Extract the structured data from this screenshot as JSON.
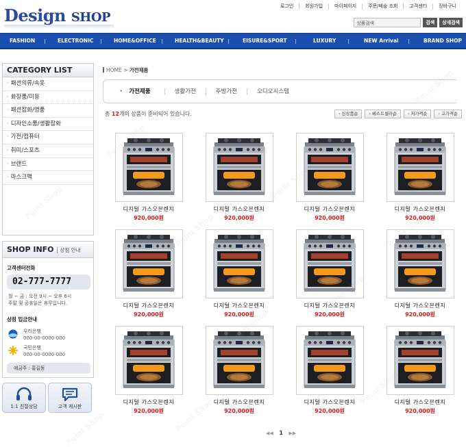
{
  "header": {
    "logo_main": "Design",
    "logo_shop": "SHOP",
    "top_links": [
      "로그인",
      "회원가입",
      "마이페이지",
      "주문/배송 조회",
      "고객센터",
      "장바구니"
    ],
    "search_placeholder": "상품검색",
    "search_button": "검색",
    "advanced_search_button": "상세검색"
  },
  "nav": [
    "FASHION",
    "ELECTRONIC",
    "HOME&OFFICE",
    "HEALTH&BEAUTY",
    "EISURE&SPORT",
    "LUXURY",
    "NEW Arrival",
    "BRAND SHOP"
  ],
  "sidebar": {
    "category_title": "CATEGORY LIST",
    "categories": [
      "패션의류/속옷",
      "화장품/미용",
      "패션잡화/명품",
      "디자인소품/생활잡화",
      "가전/컴퓨터",
      "취미/스포츠",
      "브랜드",
      "마스크팩"
    ],
    "shop_info_title": "SHOP INFO",
    "shop_info_sub": "상점 안내",
    "cs_label": "고객센터전화",
    "phone": "02-777-7777",
    "hours_line1": "월 ~ 금 : 오전 9시 ~ 오후 6시",
    "hours_line2": "주말 및 공휴일은 휴무입니다.",
    "bank_label": "상점 입금안내",
    "banks": [
      {
        "name": "우리은행",
        "account": "000-00-0000-000"
      },
      {
        "name": "국민은행",
        "account": "000-00-0000-000"
      }
    ],
    "depositor": "예금주 : 홍길동",
    "cs_buttons": [
      "1:1 친절상담",
      "고객 게시판"
    ]
  },
  "main": {
    "breadcrumb_home": "HOME",
    "breadcrumb_current": "가전제품",
    "subtabs": [
      "가전제품",
      "생활가전",
      "주방가전",
      "오디오시스템"
    ],
    "count_prefix": "총",
    "count": "12",
    "count_suffix": "개의 상품이 준비되어 있습니다.",
    "sort_buttons": [
      "신상품순",
      "베스트셀러순",
      "저가격순",
      "고가격순"
    ],
    "products": [
      {
        "name": "디지털 가스오븐렌지",
        "price": "920,000원"
      },
      {
        "name": "디지털 가스오븐렌지",
        "price": "920,000원"
      },
      {
        "name": "디지털 가스오븐렌지",
        "price": "920,000원"
      },
      {
        "name": "디지털 가스오븐렌지",
        "price": "920,000원"
      },
      {
        "name": "디지털 가스오븐렌지",
        "price": "920,000원"
      },
      {
        "name": "디지털 가스오븐렌지",
        "price": "920,000원"
      },
      {
        "name": "디지털 가스오븐렌지",
        "price": "920,000원"
      },
      {
        "name": "디지털 가스오븐렌지",
        "price": "920,000원"
      },
      {
        "name": "디지털 가스오븐렌지",
        "price": "920,000원"
      },
      {
        "name": "디지털 가스오븐렌지",
        "price": "920,000원"
      },
      {
        "name": "디지털 가스오븐렌지",
        "price": "920,000원"
      },
      {
        "name": "디지털 가스오븐렌지",
        "price": "920,000원"
      }
    ],
    "pager": {
      "prev": "◀◀",
      "current": "1",
      "next": "▶▶"
    }
  },
  "watermark": "Point Shop",
  "colors": {
    "nav_bg": "#1a4fb0",
    "price": "#d81818",
    "logo": "#2a4a9a"
  }
}
